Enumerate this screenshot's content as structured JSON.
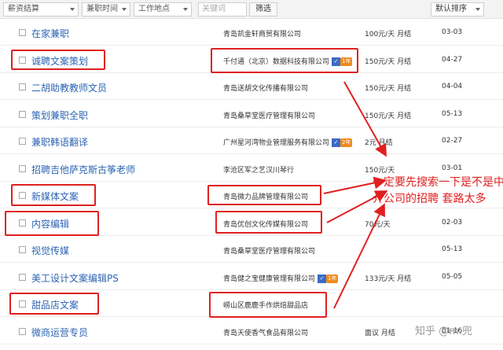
{
  "filters": {
    "salary": "薪资结算",
    "part_time": "兼职时间",
    "location": "工作地点",
    "keyword_placeholder": "关键词",
    "search_button": "筛选",
    "sort": "默认排序"
  },
  "rows": [
    {
      "title": "在家兼职",
      "company": "青岛凯金轩商贸有限公司",
      "badge": "",
      "salary": "100元/天 月结",
      "date": "03-03"
    },
    {
      "title": "诚聘文案策划",
      "company": "千付通（北京）数据科技有限公司",
      "badge": "1年",
      "salary": "150元/天 月结",
      "date": "04-27"
    },
    {
      "title": "二胡助教教师文员",
      "company": "青岛送胡文化传播有限公司",
      "badge": "",
      "salary": "150元/天 月结",
      "date": "04-04"
    },
    {
      "title": "策划兼职全职",
      "company": "青岛桑草堂医疗管理有限公司",
      "badge": "",
      "salary": "150元/天 月结",
      "date": "05-13"
    },
    {
      "title": "兼职韩语翻译",
      "company": "广州星河湾物业管理服务有限公司",
      "badge": "2年",
      "salary": "2元 月结",
      "date": "02-27"
    },
    {
      "title": "招聘吉他萨克斯古筝老师",
      "company": "李沧区军之艺汉川琴行",
      "badge": "",
      "salary": "150元/天",
      "date": "03-01"
    },
    {
      "title": "新媒体文案",
      "company": "青岛微力品牌管理有限公司",
      "badge": "",
      "salary": "",
      "date": ""
    },
    {
      "title": "内容编辑",
      "company": "青岛优创文化传媒有限公司",
      "badge": "",
      "salary": "70元/天",
      "date": "02-03"
    },
    {
      "title": "视觉传媒",
      "company": "青岛桑草堂医疗管理有限公司",
      "badge": "",
      "salary": "",
      "date": "05-13"
    },
    {
      "title": "美工设计文案编辑PS",
      "company": "青岛健之宝健康管理有限公司",
      "badge": "1年",
      "salary": "133元/天 月结",
      "date": "05-05"
    },
    {
      "title": "甜品店文案",
      "company": "崂山区鹿鹿手作烘焙甜品店",
      "badge": "",
      "salary": "",
      "date": ""
    },
    {
      "title": "微商运营专员",
      "company": "青岛天使香气食品有限公司",
      "badge": "",
      "salary": "面议 月结",
      "date": "01-16"
    }
  ],
  "annotation": "一定要先搜索一下是不是中介公司的招聘 套路太多",
  "watermark": "知乎 @m.兜",
  "colors": {
    "link": "#2d64b3",
    "highlight": "#e02020",
    "verify": "#3b6cc5",
    "year_badge": "#f08a1c"
  }
}
